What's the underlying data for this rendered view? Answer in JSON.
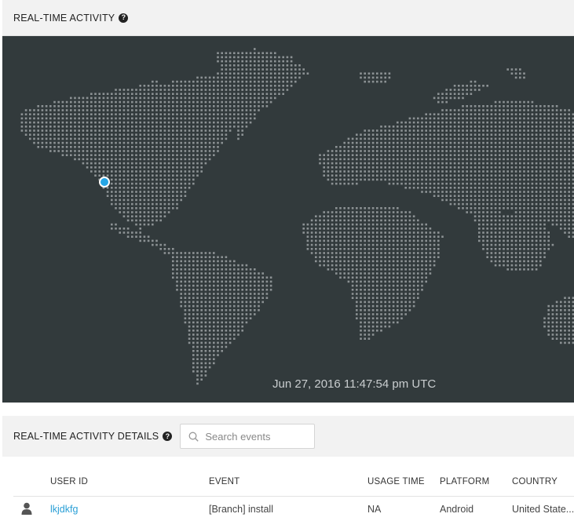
{
  "activity": {
    "title": "REAL-TIME ACTIVITY",
    "help_icon": "question-circle-icon",
    "timestamp": "Jun 27, 2016 11:47:54 pm UTC",
    "marker_color": "#25a6e6",
    "map_background": "#323a3c"
  },
  "details": {
    "title": "REAL-TIME ACTIVITY DETAILS",
    "help_icon": "question-circle-icon",
    "search_placeholder": "Search events",
    "search_value": "",
    "columns": [
      "USER ID",
      "EVENT",
      "USAGE TIME",
      "PLATFORM",
      "COUNTRY"
    ],
    "rows": [
      {
        "icon": "user-icon",
        "user_id": "lkjdkfg",
        "event": "[Branch] install",
        "usage_time": "NA",
        "platform": "Android",
        "country": "United State..."
      }
    ]
  }
}
